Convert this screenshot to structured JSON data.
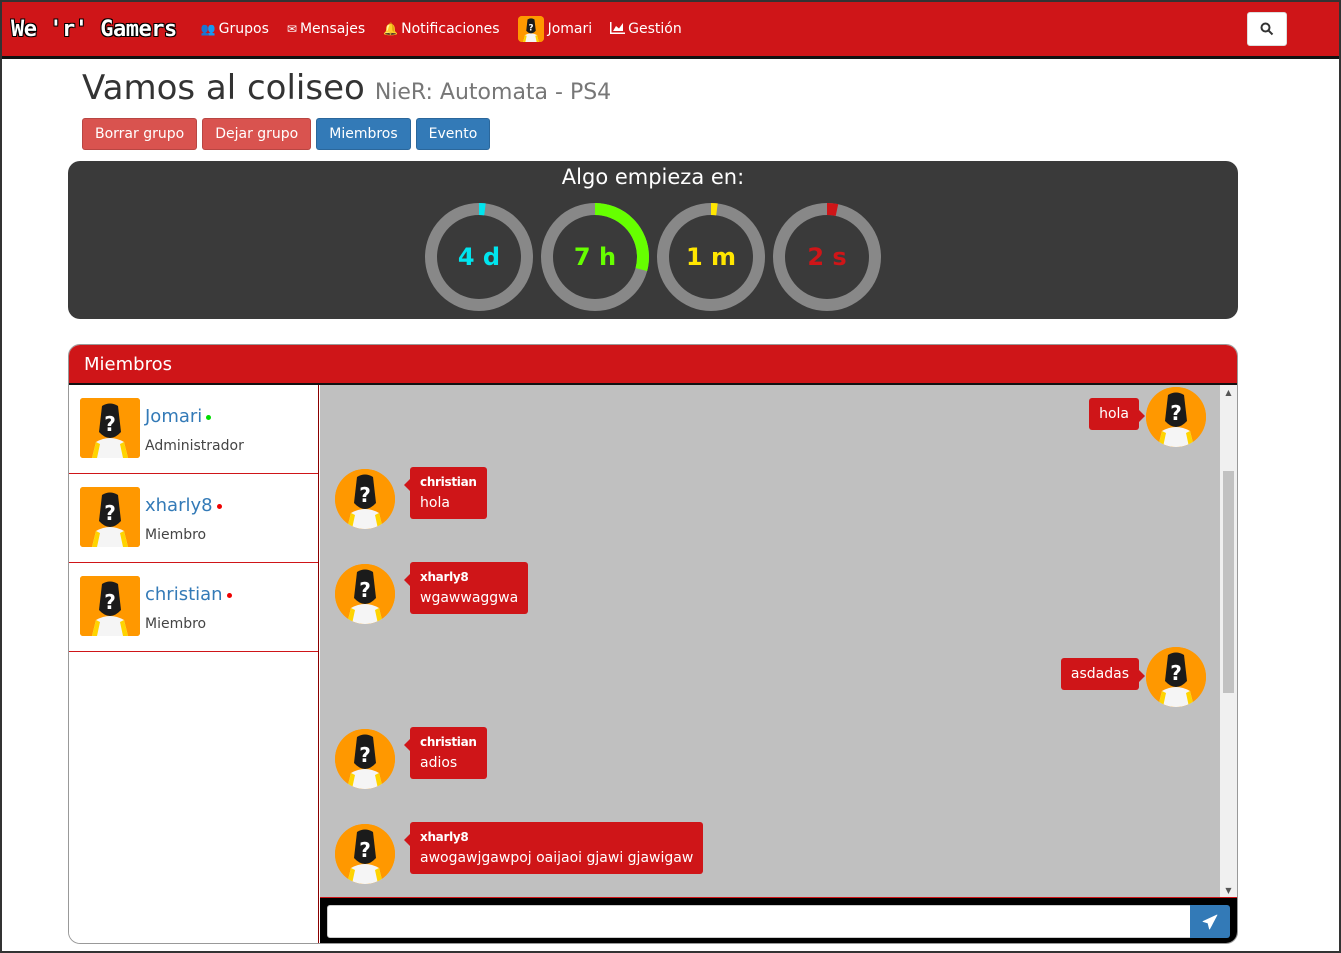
{
  "navbar": {
    "brand": "We 'r' Gamers",
    "links": [
      {
        "icon": "users-icon",
        "label": "Grupos"
      },
      {
        "icon": "envelope-icon",
        "label": "Mensajes"
      },
      {
        "icon": "bell-icon",
        "label": "Notificaciones"
      },
      {
        "icon": "avatar",
        "label": "Jomari"
      },
      {
        "icon": "chart-icon",
        "label": "Gestión"
      }
    ],
    "search_icon": "search-icon"
  },
  "group": {
    "title": "Vamos al coliseo",
    "game": "NieR: Automata - PS4",
    "buttons": {
      "delete": "Borrar grupo",
      "leave": "Dejar grupo",
      "members": "Miembros",
      "event": "Evento"
    }
  },
  "countdown": {
    "title": "Algo empieza en:",
    "units": [
      {
        "label": "4 d",
        "value": 4,
        "max": 365,
        "color": "#00e5ee"
      },
      {
        "label": "7 h",
        "value": 7,
        "max": 24,
        "color": "#66ff00"
      },
      {
        "label": "1 m",
        "value": 1,
        "max": 60,
        "color": "#ffe600"
      },
      {
        "label": "2 s",
        "value": 2,
        "max": 60,
        "color": "#cf1518"
      }
    ]
  },
  "members_panel": {
    "title": "Miembros",
    "members": [
      {
        "name": "Jomari",
        "role": "Administrador",
        "status_color": "#00dd00"
      },
      {
        "name": "xharly8",
        "role": "Miembro",
        "status_color": "#ee0000"
      },
      {
        "name": "christian",
        "role": "Miembro",
        "status_color": "#ee0000"
      }
    ]
  },
  "chat": {
    "messages": [
      {
        "side": "right",
        "author": "",
        "text": "hola"
      },
      {
        "side": "left",
        "author": "christian",
        "text": "hola"
      },
      {
        "side": "left",
        "author": "xharly8",
        "text": "wgawwaggwa"
      },
      {
        "side": "right",
        "author": "",
        "text": "asdadas"
      },
      {
        "side": "left",
        "author": "christian",
        "text": "adios"
      },
      {
        "side": "left",
        "author": "xharly8",
        "text": "awogawjgawpoj oaijaoi gjawi gjawigaw"
      }
    ],
    "input_value": "",
    "send_icon": "paper-plane-icon"
  },
  "colors": {
    "brand_red": "#cf1518",
    "primary_blue": "#337ab7",
    "danger": "#d9534f"
  }
}
